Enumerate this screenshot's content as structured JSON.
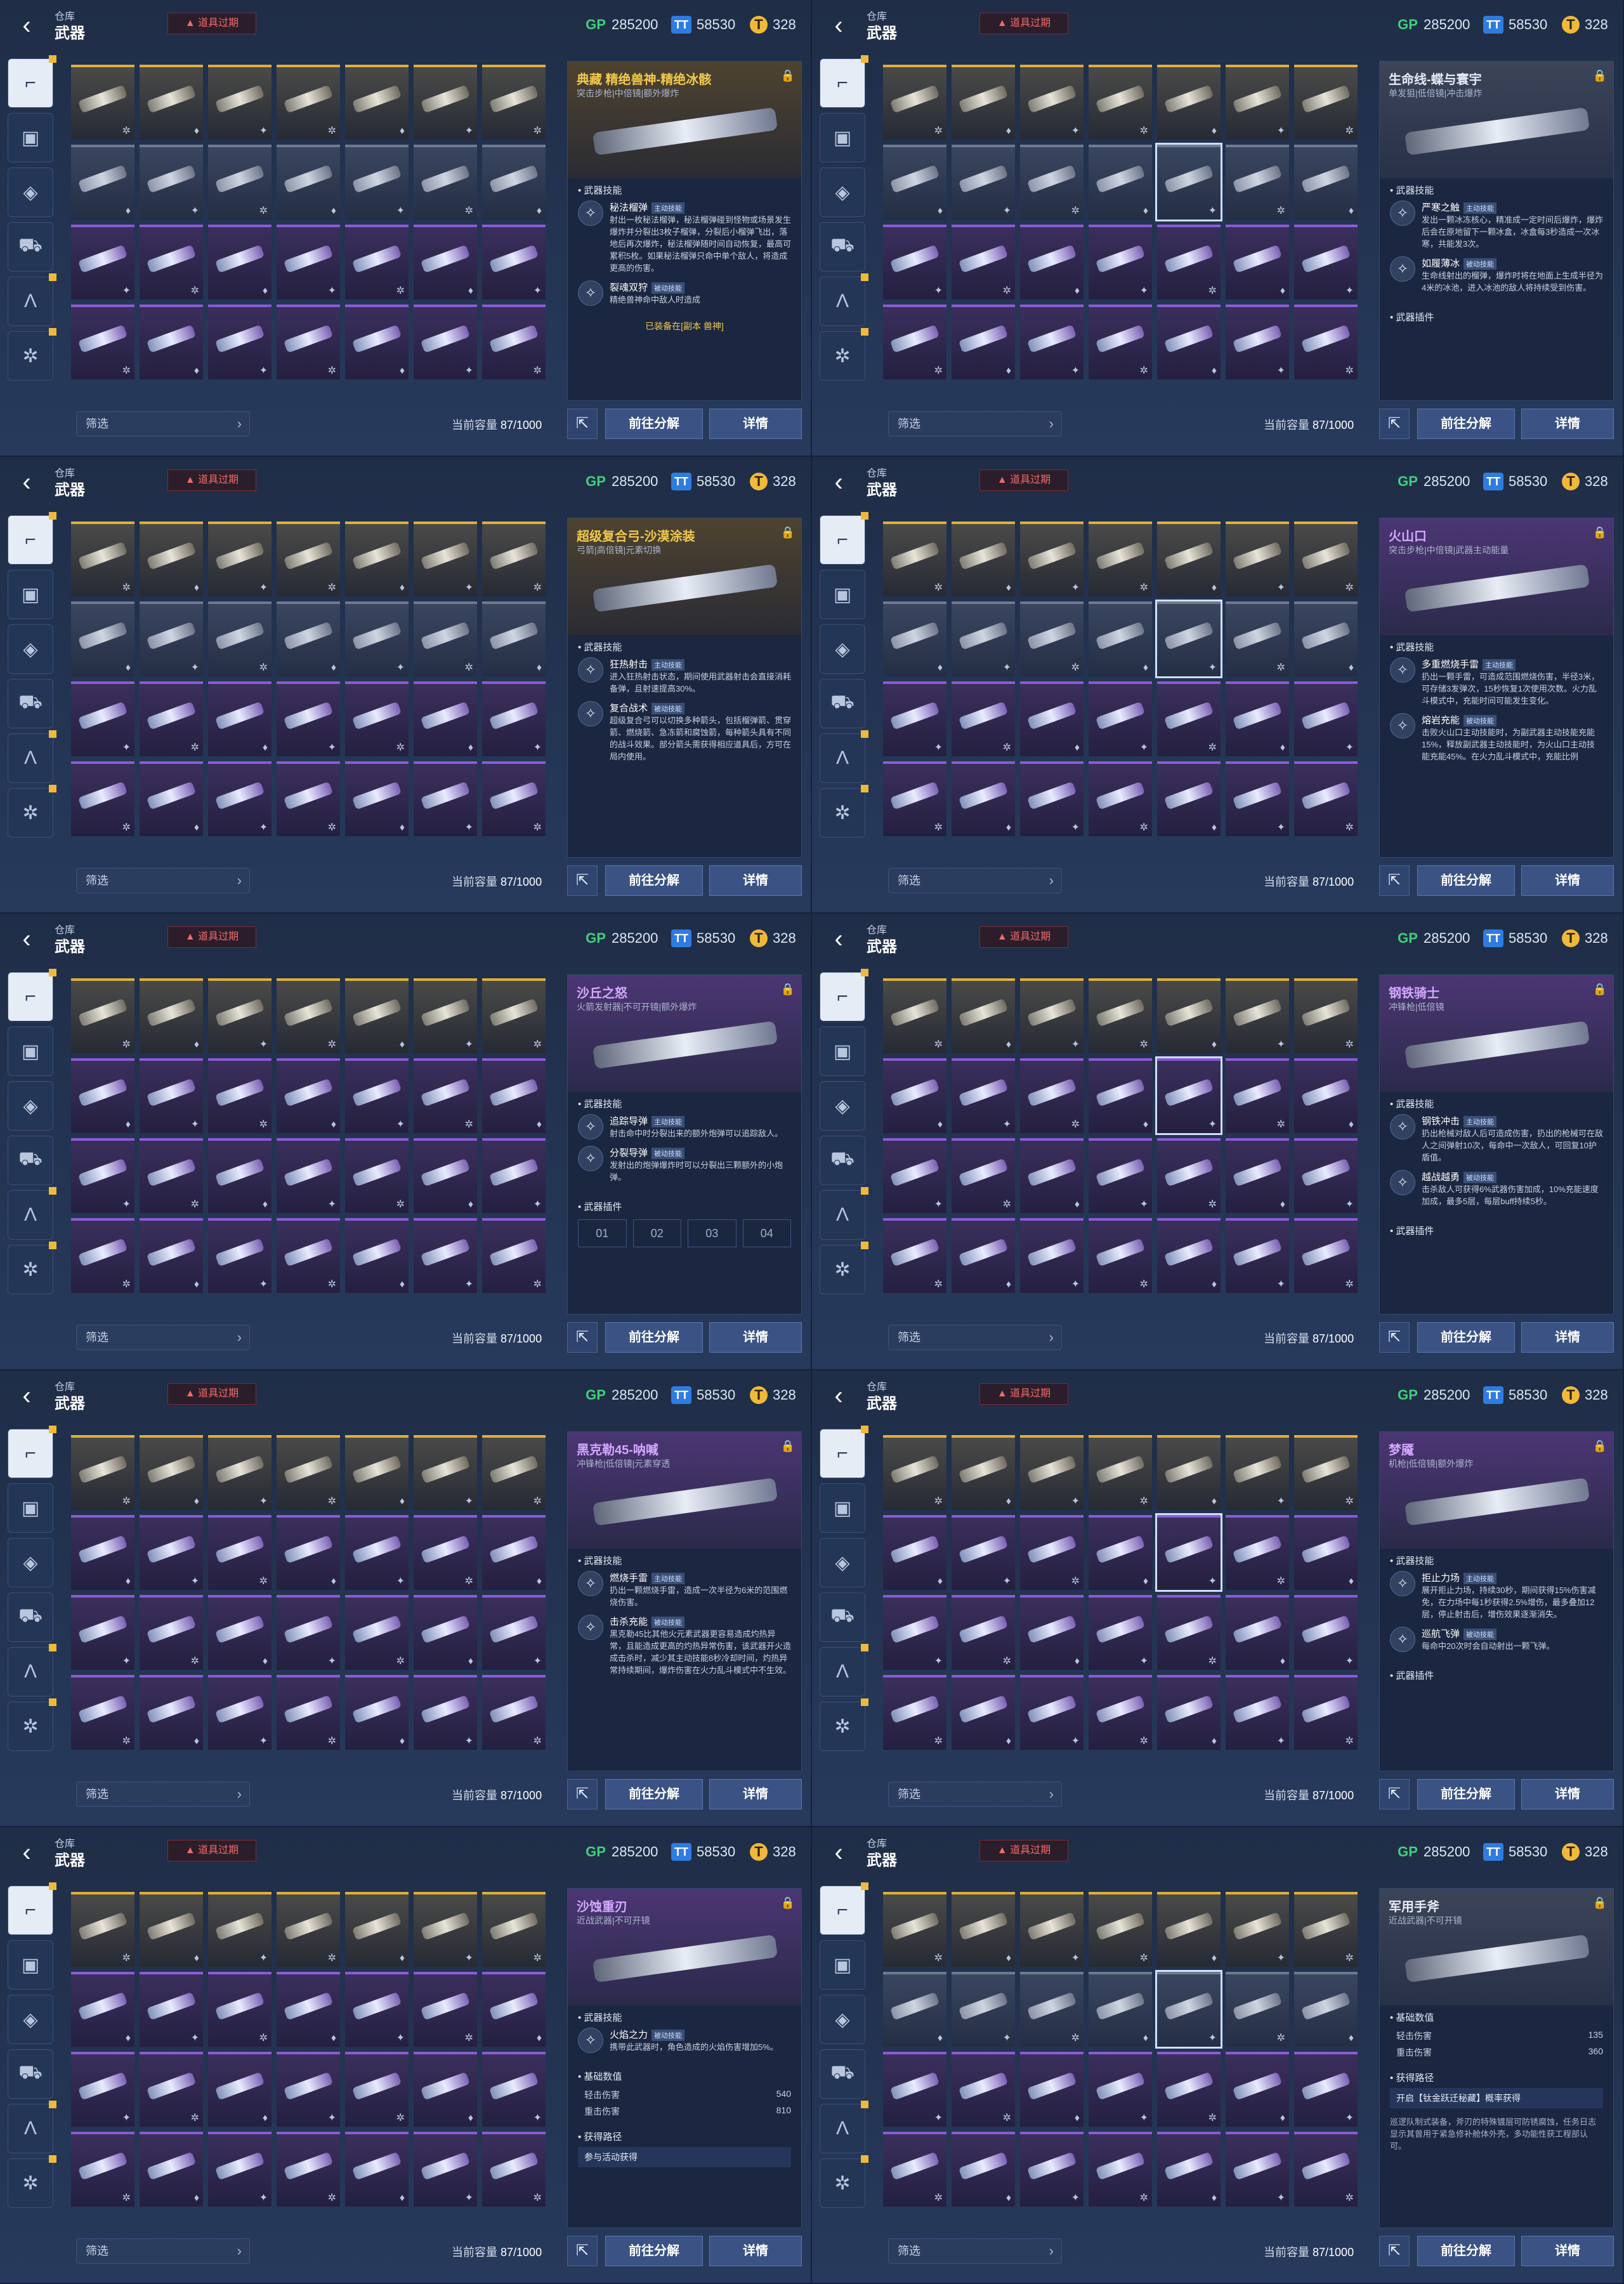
{
  "header": {
    "crumb": "仓库",
    "title": "武器",
    "expired": "道具过期",
    "gp": "285200",
    "tickets": "58530",
    "gold": "328"
  },
  "currency_icons": {
    "gp": "GP",
    "tickets": "TT",
    "gold": "T"
  },
  "footer": {
    "filter": "筛选",
    "capacity_label": "当前容量",
    "capacity_value": "87/1000",
    "decompose": "前往分解",
    "details": "详情"
  },
  "sidebar_icons": [
    "rifle-icon",
    "pistol-icon",
    "armor-icon",
    "tank-icon",
    "decal-icon",
    "skill-icon"
  ],
  "panels": [
    {
      "name": "精绝兽神-精绝冰骸",
      "prefix": "典藏",
      "type": "突击步枪|中倍镜|额外爆炸",
      "rarity": "gold",
      "sections": [
        {
          "title": "武器技能",
          "skills": [
            {
              "name": "秘法榴弹",
              "tag": "主动技能",
              "desc": "射出一枚秘法榴弹，秘法榴弹碰到怪物或场景发生爆炸并分裂出3枚子榴弹，分裂后小榴弹飞出，落地后再次爆炸，秘法榴弹随时间自动恢复，最高可累积5枚。如果秘法榴弹只命中单个敌人，将造成更高的伤害。"
            },
            {
              "name": "裂魂双狩",
              "tag": "被动技能",
              "desc": "精绝兽神命中敌人时造成"
            }
          ]
        }
      ],
      "equip": "已装备在[副本 兽神]"
    },
    {
      "name": "生命线-蝶与寰宇",
      "type": "单发狙|低倍镜|冲击爆炸",
      "rarity": "gray",
      "sections": [
        {
          "title": "武器技能",
          "skills": [
            {
              "name": "严寒之触",
              "tag": "主动技能",
              "desc": "发出一颗冰冻核心，精准成一定时间后爆炸，爆炸后会在原地留下一颗冰盒，冰盒每3秒造成一次冰寒，共能发3次。"
            },
            {
              "name": "如履薄冰",
              "tag": "被动技能",
              "desc": "生命线射出的榴弹，爆炸时将在地面上生成半径为4米的冰池，进入冰池的敌人将持续受到伤害。"
            }
          ]
        },
        {
          "title": "武器插件",
          "skills": []
        }
      ]
    },
    {
      "name": "超级复合弓-沙漠涂装",
      "type": "弓箭|高倍镜|元素切换",
      "rarity": "gold",
      "sections": [
        {
          "title": "武器技能",
          "skills": [
            {
              "name": "狂热射击",
              "tag": "主动技能",
              "desc": "进入狂热射击状态，期间使用武器射击会直接消耗备弹，且射速提高30%。"
            },
            {
              "name": "复合战术",
              "tag": "被动技能",
              "desc": "超级复合弓可以切换多种箭头，包括榴弹箭、贯穿箭、燃烧箭、急冻箭和腐蚀箭，每种箭头具有不同的战斗效果。部分箭头需获得相应道具后，方可在局内使用。"
            }
          ]
        }
      ]
    },
    {
      "name": "火山口",
      "type": "突击步枪|中倍镜|武器主动能量",
      "rarity": "purple",
      "sections": [
        {
          "title": "武器技能",
          "skills": [
            {
              "name": "多重燃烧手雷",
              "tag": "主动技能",
              "desc": "扔出一颗手雷，可造成范围燃烧伤害，半径3米，可存储3发弹次，15秒恢复1次使用次数。火力乱斗模式中，充能时间可能发生变化。"
            },
            {
              "name": "熔岩充能",
              "tag": "被动技能",
              "desc": "击败火山口主动技能时，为副武器主动技能充能15%，释放副武器主动技能时，为火山口主动技能充能45%。在火力乱斗模式中，充能比例"
            }
          ]
        }
      ]
    },
    {
      "name": "沙丘之怒",
      "type": "火箭发射器|不可开镜|额外爆炸",
      "rarity": "purple",
      "sections": [
        {
          "title": "武器技能",
          "skills": [
            {
              "name": "追踪导弹",
              "tag": "主动技能",
              "desc": "射击命中时分裂出来的额外炮弹可以追踪敌人。"
            },
            {
              "name": "分裂导弹",
              "tag": "被动技能",
              "desc": "发射出的炮弹爆炸时可以分裂出三颗额外的小炮弹。"
            }
          ]
        },
        {
          "title": "武器插件",
          "plugins": [
            "01",
            "02",
            "03",
            "04"
          ]
        }
      ]
    },
    {
      "name": "钢铁骑士",
      "type": "冲锋枪|低倍镜",
      "rarity": "purple",
      "sections": [
        {
          "title": "武器技能",
          "skills": [
            {
              "name": "钢铁冲击",
              "tag": "主动技能",
              "desc": "扔出枪械对敌人后可造成伤害，扔出的枪械可在敌人之间弹射10次，每命中一次敌人，可回复10护盾值。"
            },
            {
              "name": "越战越勇",
              "tag": "被动技能",
              "desc": "击杀敌人可获得6%武器伤害加成，10%充能速度加成，最多5层，每层buff持续5秒。"
            }
          ]
        },
        {
          "title": "武器插件",
          "skills": []
        }
      ]
    },
    {
      "name": "黑克勒45-呐喊",
      "type": "冲锋枪|低倍镜|元素穿透",
      "rarity": "purple",
      "sections": [
        {
          "title": "武器技能",
          "skills": [
            {
              "name": "燃烧手雷",
              "tag": "主动技能",
              "desc": "扔出一颗燃烧手雷，造成一次半径为6米的范围燃烧伤害。"
            },
            {
              "name": "击杀充能",
              "tag": "被动技能",
              "desc": "黑克勒45比其他火元素武器更容易造成灼热异常，且能造成更高的灼热异常伤害，该武器开火造成击杀时，减少其主动技能8秒冷却时间，灼热异常持续期间，爆炸伤害在火力乱斗模式中不生效。"
            }
          ]
        }
      ]
    },
    {
      "name": "梦魇",
      "type": "机枪|低倍镜|额外爆炸",
      "rarity": "purple",
      "sections": [
        {
          "title": "武器技能",
          "skills": [
            {
              "name": "拒止力场",
              "tag": "主动技能",
              "desc": "展开拒止力场，持续30秒，期间获得15%伤害减免，在力场中每1秒获得2.5%增伤，最多叠加12层，停止射击后，增伤效果逐渐消失。"
            },
            {
              "name": "巡航飞弹",
              "tag": "被动技能",
              "desc": "每命中20次时会自动射出一颗飞弹。"
            }
          ]
        },
        {
          "title": "武器插件",
          "skills": []
        }
      ]
    },
    {
      "name": "沙蚀重刃",
      "type": "近战武器|不可开镜",
      "rarity": "purple",
      "sections": [
        {
          "title": "武器技能",
          "skills": [
            {
              "name": "火焰之力",
              "tag": "被动技能",
              "desc": "携带此武器时，角色造成的火焰伤害增加5%。"
            }
          ]
        },
        {
          "title": "基础数值",
          "stats": [
            {
              "k": "轻击伤害",
              "v": "540"
            },
            {
              "k": "重击伤害",
              "v": "810"
            }
          ]
        },
        {
          "title": "获得路径",
          "route": "参与活动获得"
        }
      ]
    },
    {
      "name": "军用手斧",
      "type": "近战武器|不可开镜",
      "rarity": "gray",
      "sections": [
        {
          "title": "基础数值",
          "stats": [
            {
              "k": "轻击伤害",
              "v": "135"
            },
            {
              "k": "重击伤害",
              "v": "360"
            }
          ]
        },
        {
          "title": "获得路径",
          "route": "开启【钛金跃迁秘藏】概率获得"
        }
      ],
      "lore": "巡逻队制式装备，斧刃的特殊镀层可防锈腐蚀，任务日志显示其曾用于紧急修补舱体外壳，多功能性获工程部认可。"
    }
  ],
  "colors": {
    "gold": "#e1b03a",
    "purple": "#8e5ad6",
    "accent": "#3a5284",
    "warning": "#f06a6a"
  }
}
